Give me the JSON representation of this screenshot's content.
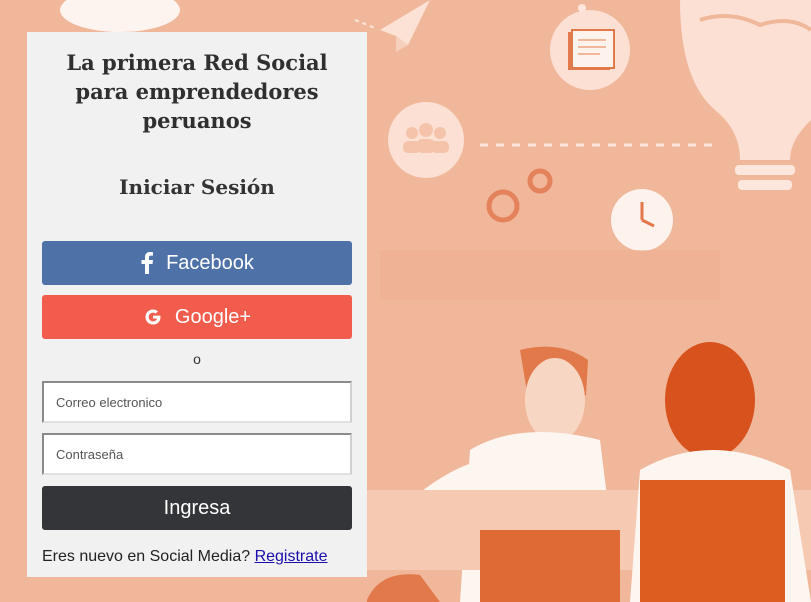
{
  "card": {
    "tagline": "La primera Red Social\npara emprendedores\nperuanos",
    "subtitle": "Iniciar Sesión"
  },
  "social": {
    "facebook_label": "Facebook",
    "facebook_icon": "facebook-f-icon",
    "google_label": "Google+",
    "google_icon": "google-g-icon"
  },
  "separator": "o",
  "form": {
    "email_placeholder": "Correo electronico",
    "email_value": "",
    "password_placeholder": "Contraseña",
    "password_value": "",
    "submit_label": "Ingresa"
  },
  "signup": {
    "prompt": "Eres nuevo en Social Media?",
    "link_label": "Registrate"
  },
  "colors": {
    "background": "#f0b79a",
    "card": "#f1f1f2",
    "facebook": "#4e71a8",
    "google": "#f15c4c",
    "submit": "#343538",
    "accent_orange": "#e0612e"
  }
}
